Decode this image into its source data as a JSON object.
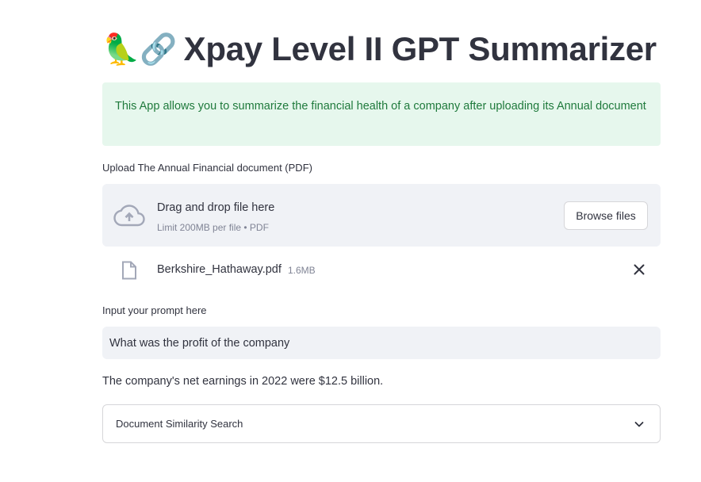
{
  "header": {
    "emoji": "🦜🔗",
    "title": "Xpay Level II GPT Summarizer"
  },
  "info": {
    "text": "This App allows you to summarize the financial health of a company after uploading its Annual document"
  },
  "uploader": {
    "label": "Upload The Annual Financial document (PDF)",
    "drop_title": "Drag and drop file here",
    "drop_subtitle": "Limit 200MB per file • PDF",
    "browse_label": "Browse files",
    "icon": "cloud-upload-icon"
  },
  "uploaded_file": {
    "name": "Berkshire_Hathaway.pdf",
    "size": "1.6MB",
    "icon": "file-icon",
    "remove_icon": "close-icon"
  },
  "prompt": {
    "label": "Input your prompt here",
    "value": "What was the profit of the company"
  },
  "answer": {
    "text": "The company's net earnings in 2022 were $12.5 billion."
  },
  "expander": {
    "label": "Document Similarity Search",
    "icon": "chevron-down-icon"
  },
  "colors": {
    "info_bg": "#e6f7ed",
    "info_text": "#1f7a3c",
    "text": "#31333f",
    "muted": "#808495",
    "input_bg": "#f0f2f6"
  }
}
